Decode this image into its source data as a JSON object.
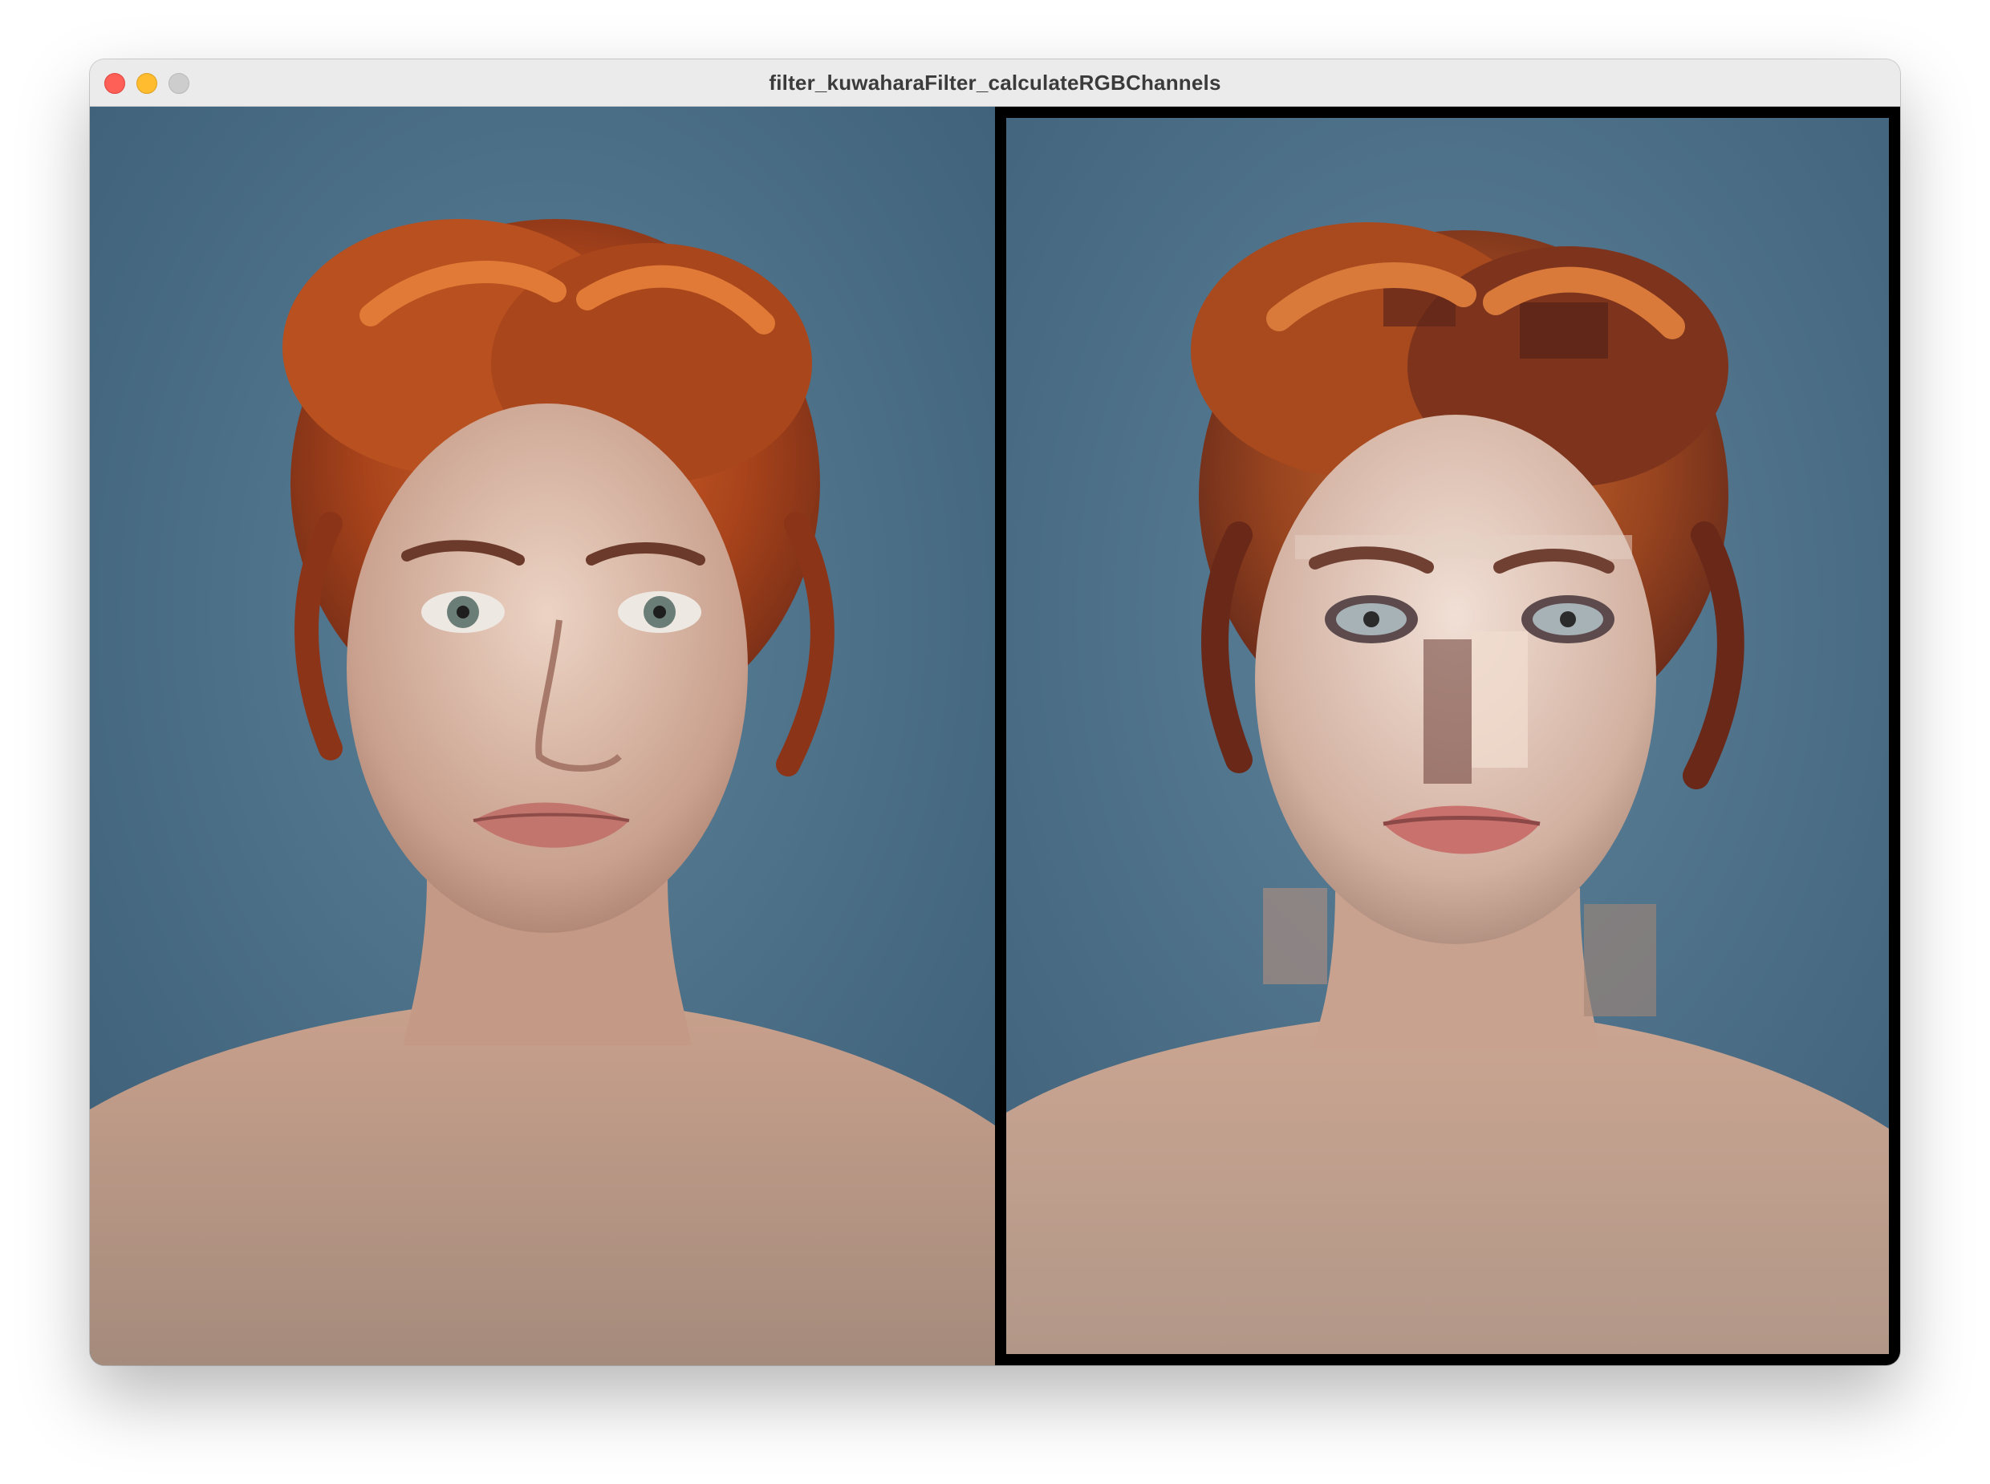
{
  "window": {
    "title": "filter_kuwaharaFilter_calculateRGBChannels"
  },
  "controls": {
    "close": "close-button",
    "minimize": "minimize-button",
    "zoom": "zoom-button"
  },
  "panels": {
    "original": {
      "icon": "portrait-photo"
    },
    "filtered": {
      "icon": "kuwahara-filtered-portrait"
    }
  },
  "colors": {
    "background": "#4a6d86",
    "hair": "#b54a1c",
    "skin": "#dcbfae",
    "frame": "#000000"
  }
}
